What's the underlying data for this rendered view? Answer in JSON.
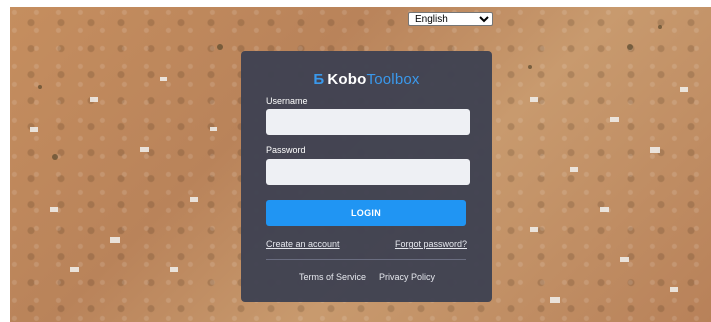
{
  "language": {
    "selected": "English"
  },
  "brand": {
    "name_bold": "Kobo",
    "name_light": "Toolbox",
    "mark": "Б"
  },
  "login": {
    "username_label": "Username",
    "password_label": "Password",
    "username_value": "",
    "password_value": "",
    "button_label": "LOGIN",
    "create_account": "Create an account",
    "forgot_password": "Forgot password?"
  },
  "footer": {
    "terms": "Terms of Service",
    "privacy": "Privacy Policy"
  },
  "colors": {
    "panel": "#404252",
    "accent": "#2095f3",
    "field": "#eef0f4"
  }
}
